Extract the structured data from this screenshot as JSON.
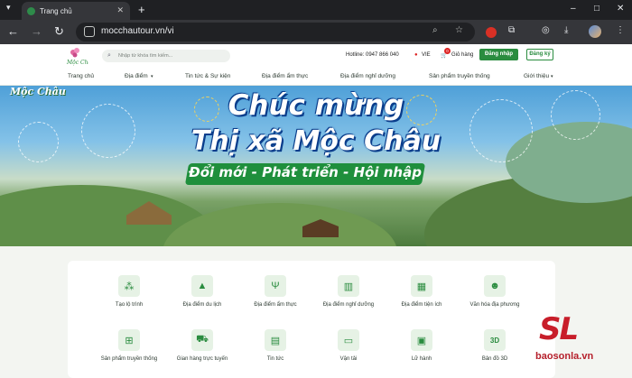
{
  "browser": {
    "tab_title": "Trang chủ",
    "new_tab": "+",
    "url": "mocchautour.vn/vi",
    "window_controls": [
      "–",
      "□",
      "✕"
    ]
  },
  "header": {
    "search_placeholder": "Nhập từ khóa tìm kiếm...",
    "hotline_label": "Hotline: 0947 866 040",
    "language": "VIE",
    "cart_label": "Giỏ hàng",
    "cart_count": "0",
    "login_label": "Đăng nhập",
    "register_label": "Đăng ký"
  },
  "nav": [
    {
      "label": "Trang chủ"
    },
    {
      "label": "Địa điểm"
    },
    {
      "label": "Tin tức & Sự kiện"
    },
    {
      "label": "Địa điểm ẩm thực"
    },
    {
      "label": "Địa điểm nghỉ dưỡng"
    },
    {
      "label": "Sản phẩm truyền thống"
    },
    {
      "label": "Giới thiệu"
    }
  ],
  "banner": {
    "logo_text": "Mộc Châu",
    "line1": "Chúc mừng",
    "line2": "Thị xã Mộc Châu",
    "line3": "Đổi mới - Phát triển - Hội nhập"
  },
  "services_row1": [
    {
      "label": "Tạo lộ trình",
      "icon": "route-icon"
    },
    {
      "label": "Địa điểm du lịch",
      "icon": "landscape-icon"
    },
    {
      "label": "Địa điểm ẩm thực",
      "icon": "food-icon"
    },
    {
      "label": "Địa điểm nghỉ dưỡng",
      "icon": "hotel-icon"
    },
    {
      "label": "Địa điểm tiện ích",
      "icon": "building-icon"
    },
    {
      "label": "Văn hóa địa phương",
      "icon": "people-icon"
    }
  ],
  "services_row2": [
    {
      "label": "Sản phẩm truyền thống",
      "icon": "basket-icon"
    },
    {
      "label": "Gian hàng trực tuyến",
      "icon": "cart-icon"
    },
    {
      "label": "Tin tức",
      "icon": "news-icon"
    },
    {
      "label": "Vận tải",
      "icon": "bus-icon"
    },
    {
      "label": "Lữ hành",
      "icon": "travel-icon"
    },
    {
      "label": "Bản đồ 3D",
      "icon": "map-3d-icon"
    }
  ],
  "watermark": {
    "mark": "SL",
    "text": "baosonla.vn"
  },
  "colors": {
    "brand_green": "#2a8c3f",
    "watermark_red": "#c81e2a"
  }
}
